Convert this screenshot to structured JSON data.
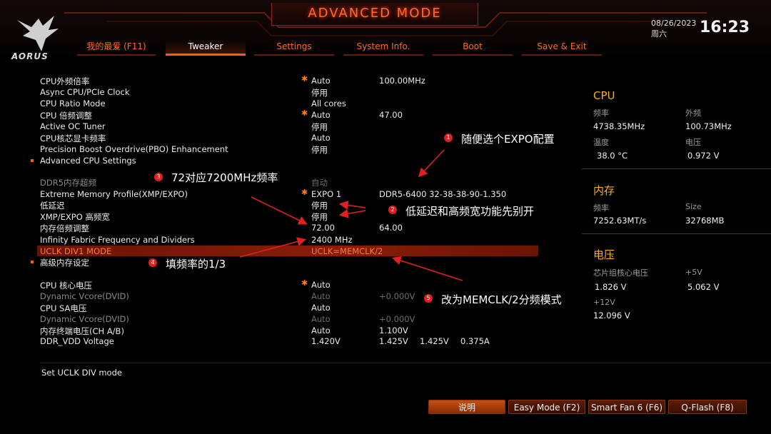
{
  "header": {
    "logo_text": "AORUS",
    "title": "ADVANCED MODE",
    "date": "08/26/2023",
    "weekday": "周六",
    "time": "16:23"
  },
  "tabs": [
    {
      "label": "我的最爱 (F11)",
      "active": false
    },
    {
      "label": "Tweaker",
      "active": true
    },
    {
      "label": "Settings",
      "active": false
    },
    {
      "label": "System Info.",
      "active": false
    },
    {
      "label": "Boot",
      "active": false
    },
    {
      "label": "Save & Exit",
      "active": false
    }
  ],
  "rows": [
    {
      "label": "CPU外频倍率",
      "star": true,
      "v1": "Auto",
      "v2": "100.00MHz"
    },
    {
      "label": "Async CPU/PCIe Clock",
      "v1": "停用"
    },
    {
      "label": "CPU Ratio Mode",
      "v1": "All cores"
    },
    {
      "label": "CPU 倍频调整",
      "star": true,
      "v1": "Auto",
      "v2": "47.00"
    },
    {
      "label": "Active OC Tuner",
      "v1": "停用"
    },
    {
      "label": "CPU核芯显卡频率",
      "v1": "Auto"
    },
    {
      "label": "Precision Boost Overdrive(PBO) Enhancement",
      "v1": "停用"
    },
    {
      "label": "Advanced CPU Settings",
      "bullet": true
    },
    {
      "label": "DDR5内存超频",
      "dim": true,
      "v1": "自动"
    },
    {
      "label": "Extreme Memory Profile(XMP/EXPO)",
      "star": true,
      "v1": "EXPO 1",
      "v2": "DDR5-6400 32-38-38-90-1.350"
    },
    {
      "label": "低延迟",
      "v1": "停用"
    },
    {
      "label": "XMP/EXPO 高频宽",
      "v1": "停用"
    },
    {
      "label": "内存倍频调整",
      "v1": "72.00",
      "v2": "64.00"
    },
    {
      "label": "Infinity Fabric Frequency and Dividers",
      "v1": "2400 MHz"
    },
    {
      "label": "UCLK DIV1 MODE",
      "selected": true,
      "v1": "UCLK=MEMCLK/2"
    },
    {
      "label": "高级内存设定",
      "bullet": true
    },
    {
      "label": "CPU 核心电压",
      "star": true,
      "v1": "Auto"
    },
    {
      "label": "Dynamic Vcore(DVID)",
      "dim": true,
      "v1": "Auto",
      "v2": "+0.000V"
    },
    {
      "label": "CPU SA电压",
      "v1": "Auto"
    },
    {
      "label": "Dynamic Vcore(DVID)",
      "dim": true,
      "v1": "Auto",
      "v2": "+0.000V"
    },
    {
      "label": "内存终端电压(CH A/B)",
      "v1": "Auto",
      "v2": "1.100V"
    },
    {
      "label": "DDR_VDD Voltage",
      "v1": "1.420V",
      "v2": "1.425V",
      "v3": "1.425V",
      "v4": "0.375A"
    }
  ],
  "annotations": [
    {
      "num": "1",
      "text": "随便选个EXPO配置"
    },
    {
      "num": "2",
      "text": "低延迟和高频宽功能先别开"
    },
    {
      "num": "3",
      "text": "72对应7200MHz频率"
    },
    {
      "num": "4",
      "text": "填频率的1/3"
    },
    {
      "num": "5",
      "text": "改为MEMCLK/2分频模式"
    }
  ],
  "side": {
    "cpu": {
      "title": "CPU",
      "freq_label": "频率",
      "freq": "4738.35MHz",
      "bclk_label": "外频",
      "bclk": "100.73MHz",
      "temp_label": "温度",
      "temp": "38.0 °C",
      "volt_label": "电压",
      "volt": "0.972 V"
    },
    "memory": {
      "title": "内存",
      "freq_label": "频率",
      "freq": "7252.63MT/s",
      "size_label": "Size",
      "size": "32768MB"
    },
    "voltage": {
      "title": "电压",
      "chipset_label": "芯片组核心电压",
      "chipset": "1.826 V",
      "v5_label": "+5V",
      "v5": "5.062 V",
      "v12_label": "+12V",
      "v12": "12.096 V"
    }
  },
  "help_text": "Set UCLK DIV mode",
  "buttons": {
    "help": "说明",
    "easy": "Easy Mode (F2)",
    "fan": "Smart Fan 6 (F6)",
    "qflash": "Q-Flash (F8)"
  },
  "colors": {
    "accent": "#ff5a10",
    "selection": "#8a1c08",
    "section_title": "#f5b21a",
    "annotation": "#e02020"
  }
}
